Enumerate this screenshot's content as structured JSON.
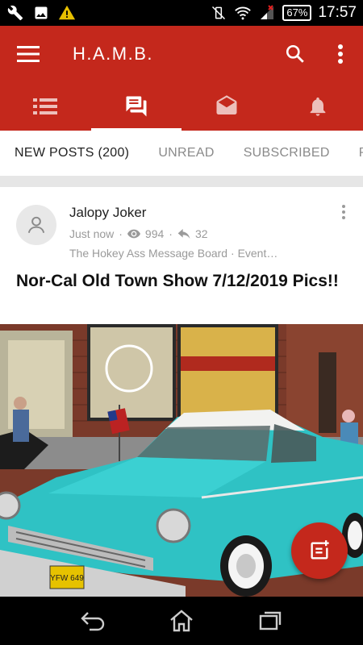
{
  "status_bar": {
    "battery": "67%",
    "time": "17:57",
    "icons": [
      "wrench-icon",
      "image-icon",
      "warning-icon",
      "vibrate-off-icon",
      "wifi-icon",
      "signal-icon",
      "battery-icon"
    ]
  },
  "app_bar": {
    "title": "H.A.M.B.",
    "icons": [
      "menu-icon",
      "search-icon",
      "more-vert-icon"
    ]
  },
  "section_tabs": [
    {
      "icon": "list-icon",
      "active": false
    },
    {
      "icon": "chat-icon",
      "active": true
    },
    {
      "icon": "mail-open-icon",
      "active": false
    },
    {
      "icon": "bell-icon",
      "active": false
    }
  ],
  "text_tabs": [
    {
      "label": "NEW POSTS (200)",
      "active": true
    },
    {
      "label": "UNREAD",
      "active": false
    },
    {
      "label": "SUBSCRIBED",
      "active": false
    },
    {
      "label": "P",
      "active": false
    }
  ],
  "post": {
    "author": "Jalopy Joker",
    "time": "Just now",
    "views": "994",
    "replies": "32",
    "forum": "The Hokey Ass Message Board",
    "subforum": "Event…",
    "title": "Nor-Cal Old Town Show 7/12/2019 Pics!!",
    "plate": "YFW 649"
  },
  "colors": {
    "primary": "#c4281c",
    "car": "#2fc2c4"
  }
}
